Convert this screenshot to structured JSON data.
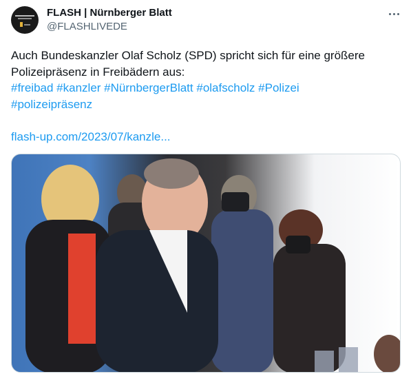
{
  "author": {
    "display_name": "FLASH | Nürnberger Blatt",
    "handle": "@FLASHLIVEDE",
    "avatar_logo_text": "NÜRNBERGER BLATT FLASH"
  },
  "tweet": {
    "text_line1": "Auch Bundeskanzler Olaf Scholz (SPD) spricht sich für eine größere",
    "text_line2": "Polizeipräsenz in Freibädern aus:",
    "hashtags": [
      "#freibad",
      "#kanzler",
      "#NürnbergerBlatt",
      "#olafscholz",
      "#Polizei",
      "#polizeipräsenz"
    ],
    "link": "flash-up.com/2023/07/kanzle..."
  },
  "media": {
    "description_icon": "photo-of-smiling-man-in-dark-suit-with-photographers"
  },
  "colors": {
    "accent": "#1d9bf0",
    "text": "#0f1419",
    "secondary": "#536471"
  }
}
